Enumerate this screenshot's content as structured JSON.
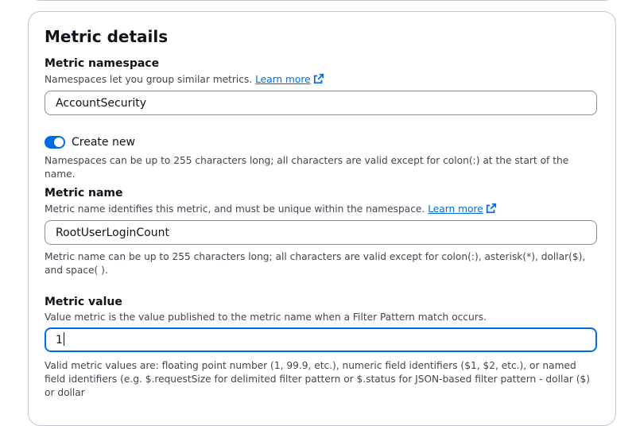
{
  "section": {
    "title": "Metric details"
  },
  "namespace": {
    "label": "Metric namespace",
    "description": "Namespaces let you group similar metrics.",
    "learn_more": "Learn more",
    "value": "AccountSecurity",
    "toggle_label": "Create new",
    "toggle_on": true,
    "hint": "Namespaces can be up to 255 characters long; all characters are valid except for colon(:) at the start of the name."
  },
  "metric_name": {
    "label": "Metric name",
    "description": "Metric name identifies this metric, and must be unique within the namespace.",
    "learn_more": "Learn more",
    "value": "RootUserLoginCount",
    "hint": "Metric name can be up to 255 characters long; all characters are valid except for colon(:), asterisk(*), dollar($), and space( )."
  },
  "metric_value": {
    "label": "Metric value",
    "description": "Value metric is the value published to the metric name when a Filter Pattern match occurs.",
    "value": "1",
    "hint": "Valid metric values are: floating point number (1, 99.9, etc.), numeric field identifiers ($1, $2, etc.), or named field identifiers (e.g. $.requestSize for delimited filter pattern or $.status for JSON-based filter pattern - dollar ($) or dollar"
  },
  "colors": {
    "accent": "#006ce0",
    "border": "#8c8c94",
    "text": "#0f141a",
    "secondary_text": "#424650"
  }
}
